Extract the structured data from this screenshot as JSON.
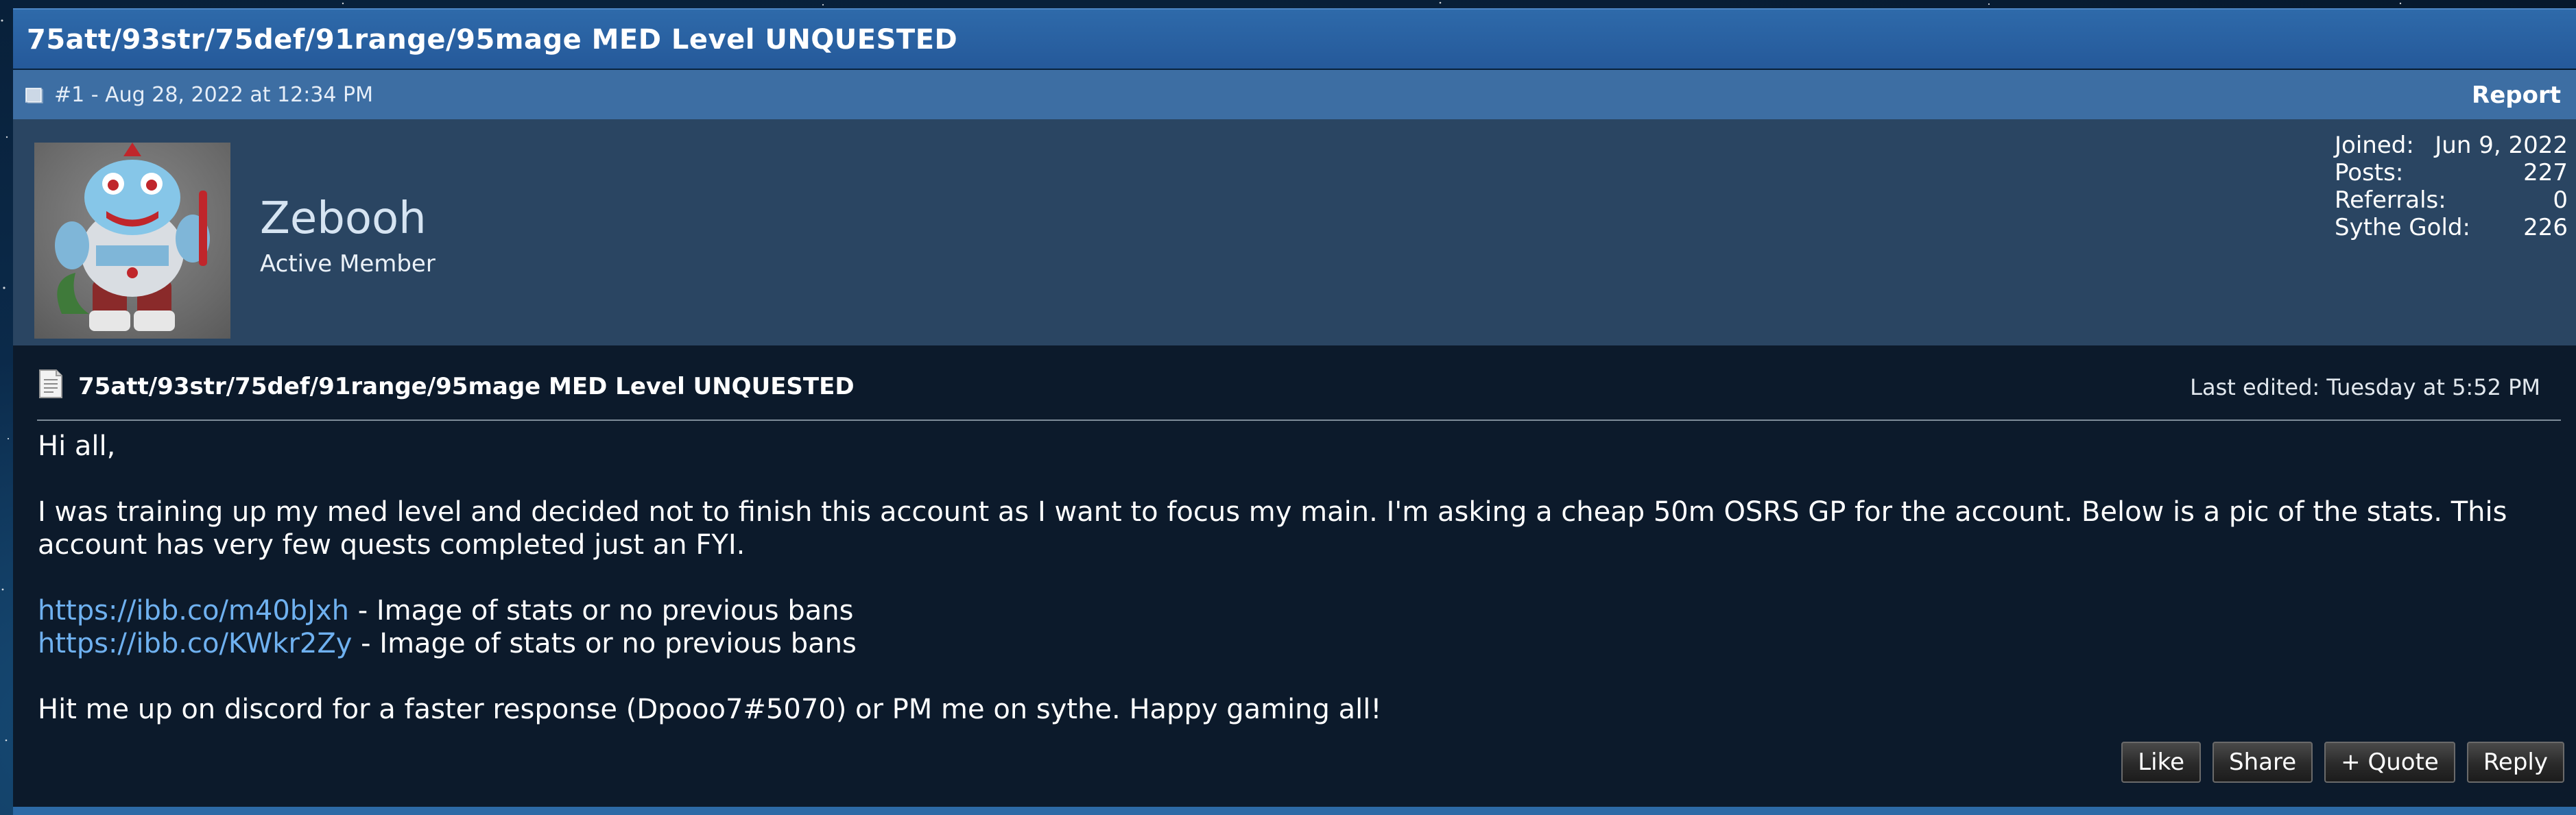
{
  "thread": {
    "title": "75att/93str/75def/91range/95mage MED Level UNQUESTED"
  },
  "post": {
    "meta": "#1 - Aug 28, 2022 at 12:34 PM",
    "report_label": "Report",
    "title": "75att/93str/75def/91range/95mage MED Level UNQUESTED",
    "last_edited": "Last edited: Tuesday at 5:52 PM",
    "body": {
      "greeting": "Hi all,",
      "paragraph": "I was training up my med level and decided not to finish this account as I want to focus my main. I'm asking a cheap 50m OSRS GP for the account. Below is a pic of the stats. This account has very few quests completed just an FYI.",
      "links": [
        {
          "url": "https://ibb.co/m40bJxh",
          "desc": " - Image of stats or no previous bans"
        },
        {
          "url": "https://ibb.co/KWkr2Zy",
          "desc": " - Image of stats or no previous bans"
        }
      ],
      "closing": "Hit me up on discord for a faster response (Dpooo7#5070) or PM me on sythe. Happy gaming all!"
    },
    "actions": {
      "like": "Like",
      "share": "Share",
      "quote": "+ Quote",
      "reply": "Reply"
    }
  },
  "user": {
    "name": "Zebooh",
    "title": "Active Member",
    "stats": [
      {
        "label": "Joined:",
        "value": "Jun 9, 2022"
      },
      {
        "label": "Posts:",
        "value": "227"
      },
      {
        "label": "Referrals:",
        "value": "0"
      },
      {
        "label": "Sythe Gold:",
        "value": "226"
      }
    ]
  },
  "colors": {
    "header_blue": "#2e6aaa",
    "postbit_blue": "#3d6ea3",
    "userinfo_bg": "#2a4562",
    "body_bg": "#0c1a2b",
    "link": "#6fb1f0"
  },
  "icons": [
    "post-icon",
    "document-icon",
    "avatar-image"
  ]
}
